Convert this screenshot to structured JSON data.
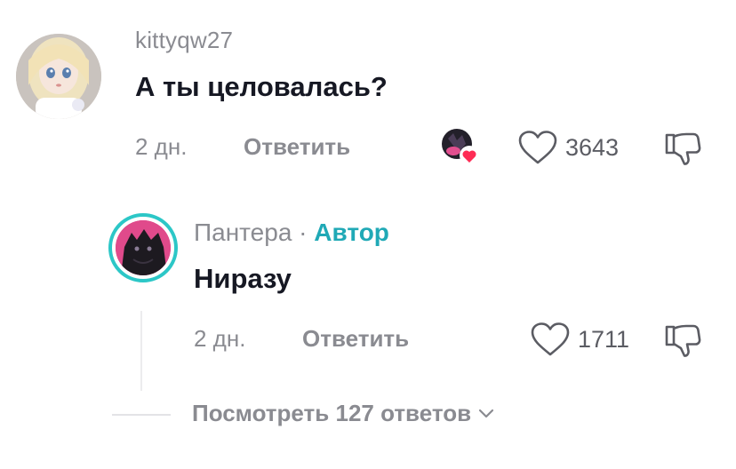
{
  "comment": {
    "username": "kittyqw27",
    "text": "А ты целовалась?",
    "time": "2 дн.",
    "reply_label": "Ответить",
    "likes": "3643"
  },
  "reply": {
    "username": "Пантера",
    "separator": "·",
    "author_badge": "Автор",
    "text": "Ниразу",
    "time": "2 дн.",
    "reply_label": "Ответить",
    "likes": "1711"
  },
  "view_replies": {
    "label": "Посмотреть 127 ответов"
  },
  "icons": {
    "like": "heart-outline-icon",
    "dislike": "thumbs-down-icon",
    "creator_liked": "creator-liked-heart-icon",
    "expand": "chevron-down-icon"
  },
  "colors": {
    "primary_text": "#161823",
    "secondary_text": "#8a8b91",
    "author_badge": "#20a9b6",
    "avatar_ring": "#2cc7c7",
    "creator_heart": "#fe2c55"
  }
}
